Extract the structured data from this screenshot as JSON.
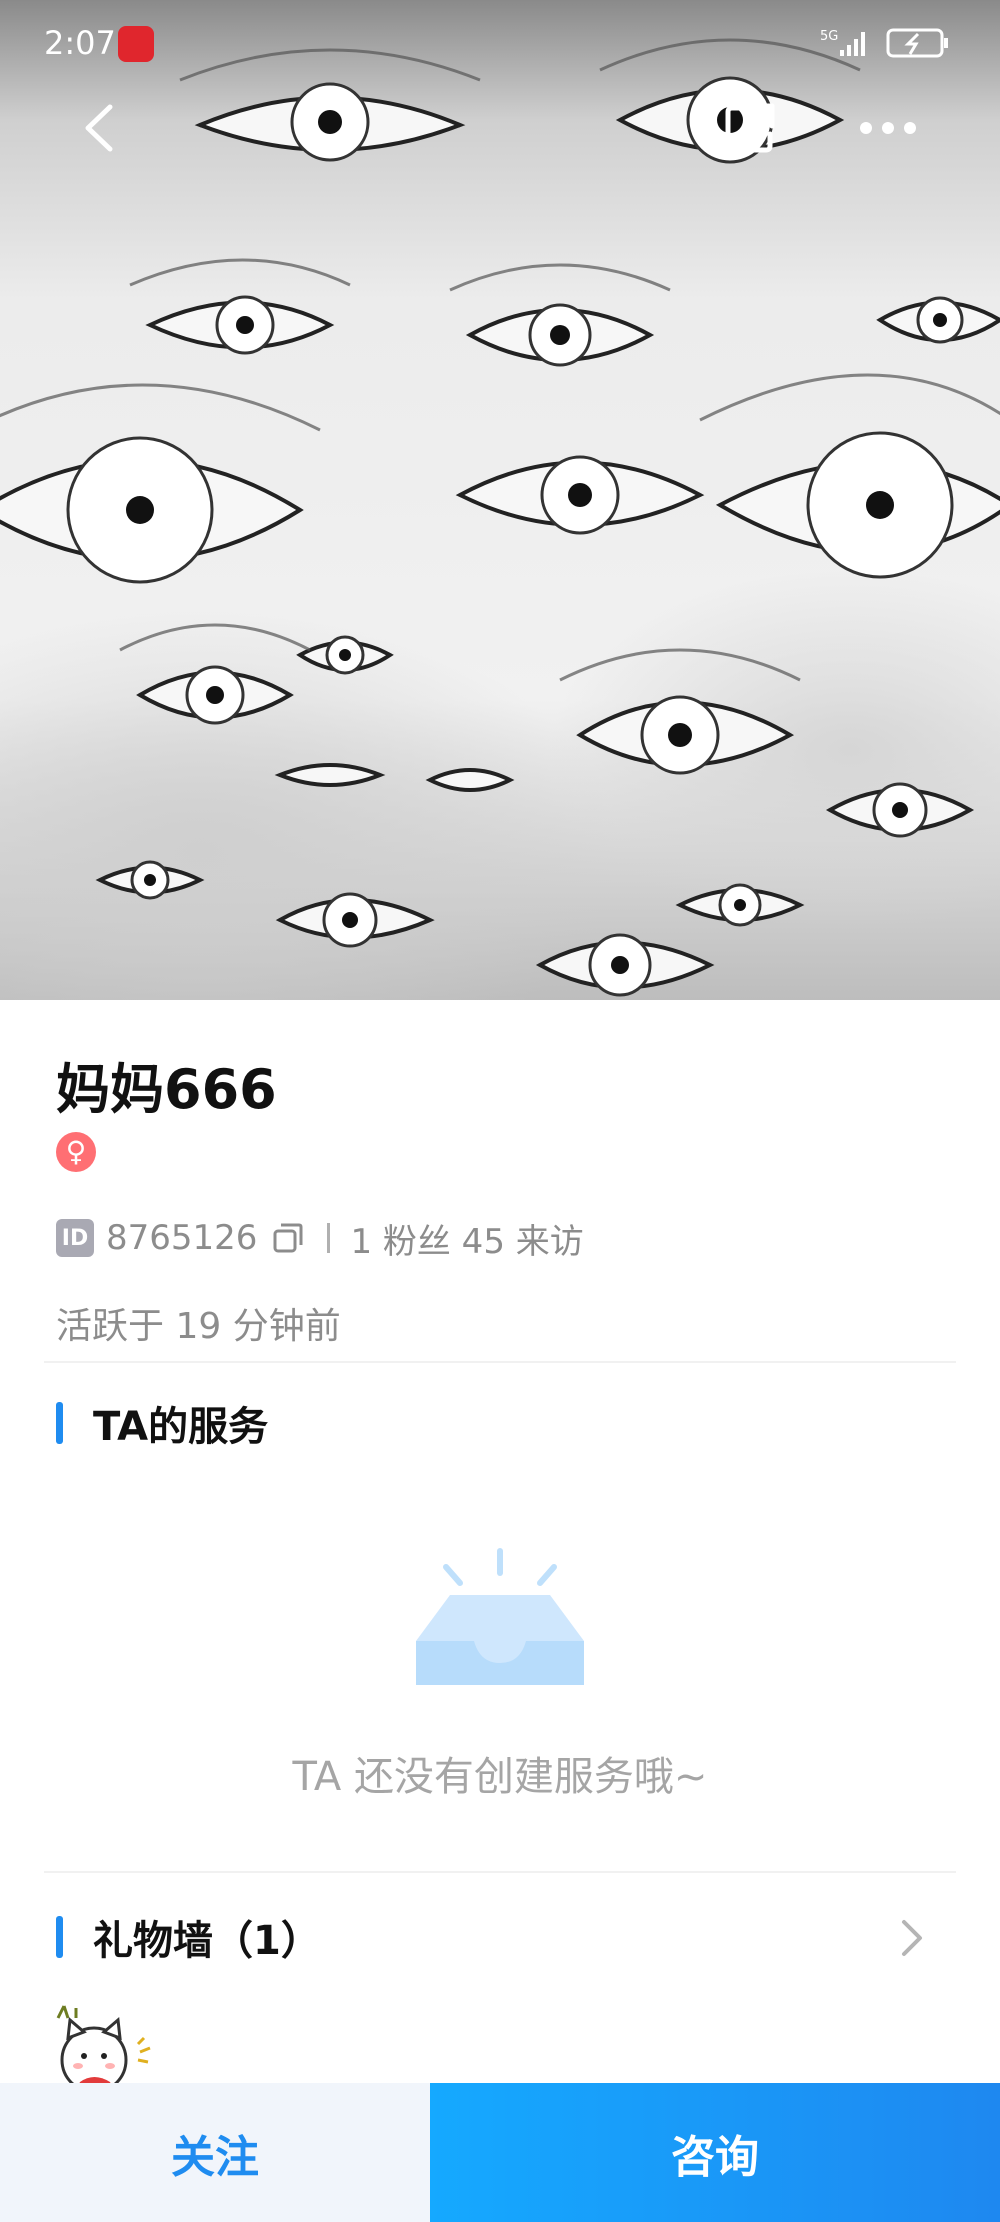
{
  "status_bar": {
    "time": "2:07",
    "network": "5G"
  },
  "profile": {
    "name": "妈妈666",
    "gender_symbol": "♀",
    "id_badge": "ID",
    "user_id": "8765126",
    "stats": "1 粉丝 45 来访",
    "active_text": "活跃于 19 分钟前"
  },
  "services": {
    "title": "TA的服务",
    "empty_text": "TA 还没有创建服务哦~"
  },
  "gifts": {
    "title": "礼物墙（1）"
  },
  "actions": {
    "follow_label": "关注",
    "consult_label": "咨询"
  },
  "colors": {
    "accent": "#1f8cf0",
    "gender_female": "#ff6f73",
    "muted_text": "#8c8c8c"
  }
}
